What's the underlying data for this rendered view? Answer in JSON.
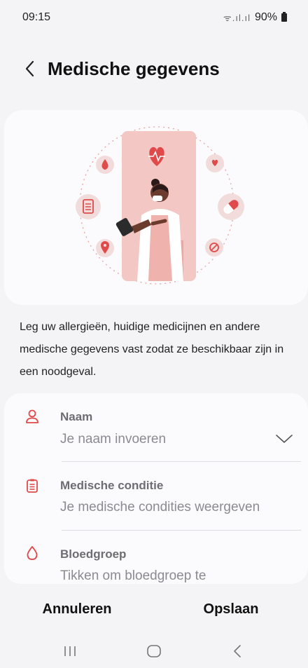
{
  "status_bar": {
    "time": "09:15",
    "signal_text": "ᯤ.ıl.ıl",
    "battery": "90%",
    "battery_icon": "battery-icon"
  },
  "header": {
    "title": "Medische gegevens",
    "back_icon": "chevron-left-icon"
  },
  "illustration": {
    "description_icons": [
      "heart-pulse-icon",
      "blood-drop-icon",
      "heart-hand-icon",
      "clipboard-icon",
      "pill-icon",
      "location-pin-icon",
      "no-entry-icon"
    ]
  },
  "description": "Leg uw allergieën, huidige medicijnen en andere medische gegevens vast zodat ze beschikbaar zijn in een noodgeval.",
  "form": {
    "fields": [
      {
        "label": "Naam",
        "value": "Je naam invoeren",
        "icon": "person-icon"
      },
      {
        "label": "Medische conditie",
        "value": "Je medische condities weergeven",
        "icon": "clipboard-icon"
      },
      {
        "label": "Bloedgroep",
        "value": "Tikken om bloedgroep te",
        "icon": "drop-icon"
      }
    ],
    "expand_icon": "chevron-down-icon"
  },
  "actions": {
    "cancel": "Annuleren",
    "save": "Opslaan"
  },
  "nav": {
    "recents": "recents-icon",
    "home": "home-icon",
    "back": "back-icon"
  },
  "colors": {
    "accent": "#e04a4a",
    "background": "#f4f4f6",
    "card": "#fbfbfd",
    "illustration_panel": "#f3c7c4"
  }
}
